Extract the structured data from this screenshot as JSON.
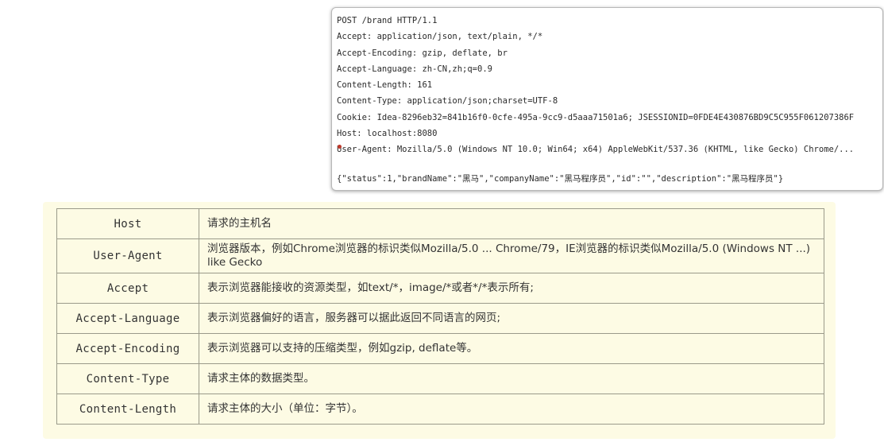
{
  "http_request": {
    "lines": [
      "POST /brand HTTP/1.1",
      "Accept: application/json, text/plain, */*",
      "Accept-Encoding: gzip, deflate, br",
      "Accept-Language: zh-CN,zh;q=0.9",
      "Content-Length: 161",
      "Content-Type: application/json;charset=UTF-8",
      "Cookie: Idea-8296eb32=841b16f0-0cfe-495a-9cc9-d5aaa71501a6; JSESSIONID=0FDE4E430876BD9C5C955F061207386F",
      "Host: localhost:8080",
      "User-Agent: Mozilla/5.0 (Windows NT 10.0; Win64; x64) AppleWebKit/537.36 (KHTML, like Gecko) Chrome/..."
    ],
    "body": "{\"status\":1,\"brandName\":\"黑马\",\"companyName\":\"黑马程序员\",\"id\":\"\",\"description\":\"黑马程序员\"}"
  },
  "headers_table": {
    "rows": [
      {
        "name": "Host",
        "description": "请求的主机名"
      },
      {
        "name": "User-Agent",
        "description": "浏览器版本，例如Chrome浏览器的标识类似Mozilla/5.0 ... Chrome/79，IE浏览器的标识类似Mozilla/5.0 (Windows NT ...) like Gecko"
      },
      {
        "name": "Accept",
        "description": "表示浏览器能接收的资源类型，如text/*，image/*或者*/*表示所有;"
      },
      {
        "name": "Accept-Language",
        "description": "表示浏览器偏好的语言，服务器可以据此返回不同语言的网页;"
      },
      {
        "name": "Accept-Encoding",
        "description": "表示浏览器可以支持的压缩类型，例如gzip, deflate等。"
      },
      {
        "name": "Content-Type",
        "description": "请求主体的数据类型。"
      },
      {
        "name": "Content-Length",
        "description": "请求主体的大小（单位：字节）。"
      }
    ]
  }
}
